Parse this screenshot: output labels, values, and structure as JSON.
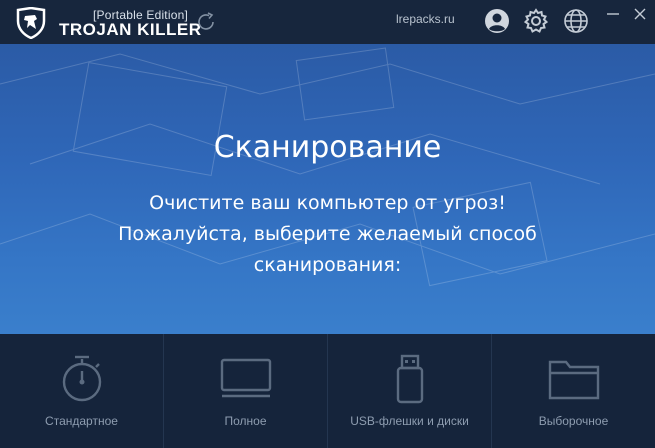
{
  "titlebar": {
    "edition": "[Portable Edition]",
    "app_name": "TROJAN KILLER",
    "site_link": "lrepacks.ru",
    "icons": [
      "refresh-icon",
      "user-icon",
      "gear-icon",
      "globe-icon",
      "minimize-icon",
      "close-icon"
    ]
  },
  "hero": {
    "title": "Сканирование",
    "subtitle_lines": [
      "Очистите ваш компьютер от угроз!",
      "Пожалуйста, выберите желаемый способ",
      "сканирования:"
    ]
  },
  "scan_options": [
    {
      "label": "Стандартное",
      "icon": "stopwatch-icon"
    },
    {
      "label": "Полное",
      "icon": "monitor-icon"
    },
    {
      "label": "USB-флешки и диски",
      "icon": "usb-drive-icon"
    },
    {
      "label": "Выборочное",
      "icon": "folder-icon"
    }
  ],
  "colors": {
    "titlebar_bg": "#17263d",
    "hero_top": "#2b5ba6",
    "hero_bottom": "#3a7fcc",
    "options_bg": "#15243b",
    "option_text": "#8e9db0",
    "icon_gray": "#5b6b80"
  }
}
